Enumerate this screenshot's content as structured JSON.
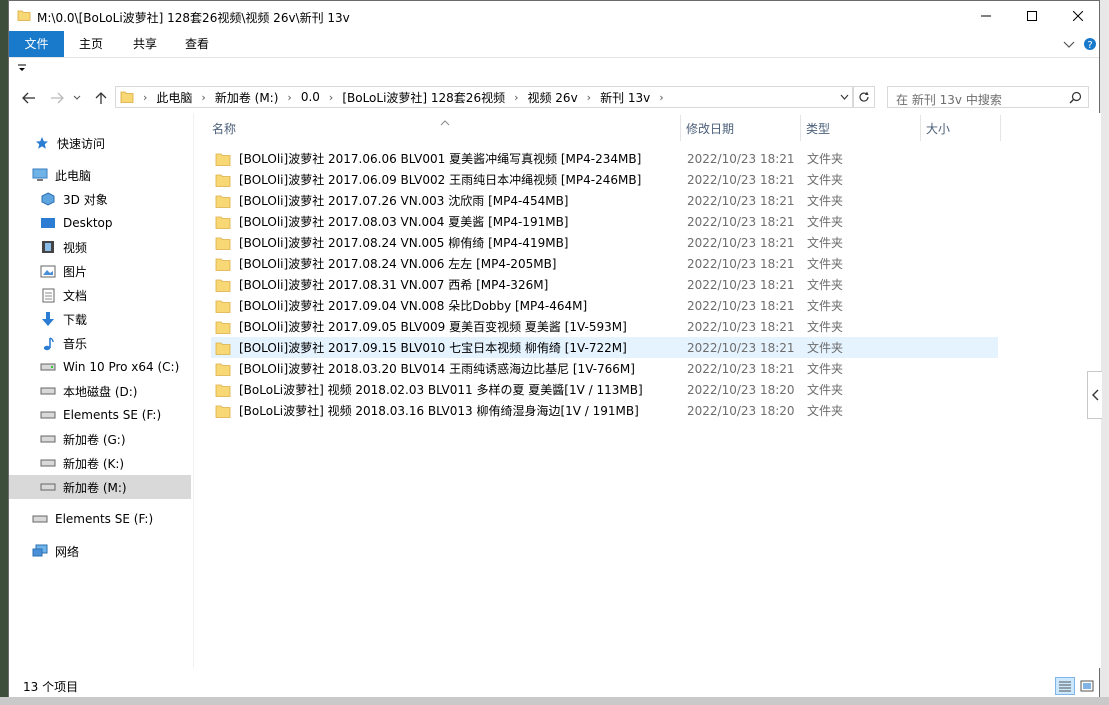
{
  "window": {
    "title": "M:\\0.0\\[BoLoLi波萝社] 128套26视频\\视频 26v\\新刊 13v"
  },
  "ribbon": {
    "tabs": [
      "文件",
      "主页",
      "共享",
      "查看"
    ],
    "active_color": "#1979ca"
  },
  "address": {
    "crumbs": [
      "此电脑",
      "新加卷 (M:)",
      "0.0",
      "[BoLoLi波萝社] 128套26视频",
      "视频 26v",
      "新刊 13v"
    ]
  },
  "search": {
    "placeholder": "在 新刊 13v 中搜索"
  },
  "nav": {
    "items": [
      {
        "label": "快速访问",
        "icon": "star-icon"
      },
      {
        "label": "此电脑",
        "icon": "computer-icon"
      },
      {
        "label": "3D 对象",
        "icon": "3d-objects-icon"
      },
      {
        "label": "Desktop",
        "icon": "desktop-icon"
      },
      {
        "label": "视频",
        "icon": "video-icon"
      },
      {
        "label": "图片",
        "icon": "pictures-icon"
      },
      {
        "label": "文档",
        "icon": "documents-icon"
      },
      {
        "label": "下载",
        "icon": "download-icon"
      },
      {
        "label": "音乐",
        "icon": "music-icon"
      },
      {
        "label": "Win 10 Pro x64 (C:)",
        "icon": "drive-icon"
      },
      {
        "label": "本地磁盘 (D:)",
        "icon": "drive-icon"
      },
      {
        "label": "Elements SE (F:)",
        "icon": "drive-icon"
      },
      {
        "label": "新加卷 (G:)",
        "icon": "drive-icon"
      },
      {
        "label": "新加卷 (K:)",
        "icon": "drive-icon"
      },
      {
        "label": "新加卷 (M:)",
        "icon": "drive-icon",
        "selected": true
      },
      {
        "label": "Elements SE (F:)",
        "icon": "drive-icon"
      },
      {
        "label": "网络",
        "icon": "network-icon"
      }
    ]
  },
  "columns": {
    "name": "名称",
    "date": "修改日期",
    "type": "类型",
    "size": "大小"
  },
  "files": [
    {
      "name": "[BOLOli]波萝社 2017.06.06 BLV001 夏美酱冲绳写真视频 [MP4-234MB]",
      "date": "2022/10/23 18:21",
      "type": "文件夹"
    },
    {
      "name": "[BOLOli]波萝社 2017.06.09 BLV002 王雨纯日本冲绳视频 [MP4-246MB]",
      "date": "2022/10/23 18:21",
      "type": "文件夹"
    },
    {
      "name": "[BOLOli]波萝社 2017.07.26 VN.003 沈欣雨 [MP4-454MB]",
      "date": "2022/10/23 18:21",
      "type": "文件夹"
    },
    {
      "name": "[BOLOli]波萝社 2017.08.03 VN.004 夏美酱 [MP4-191MB]",
      "date": "2022/10/23 18:21",
      "type": "文件夹"
    },
    {
      "name": "[BOLOli]波萝社 2017.08.24 VN.005 柳侑绮 [MP4-419MB]",
      "date": "2022/10/23 18:21",
      "type": "文件夹"
    },
    {
      "name": "[BOLOli]波萝社 2017.08.24 VN.006 左左 [MP4-205MB]",
      "date": "2022/10/23 18:21",
      "type": "文件夹"
    },
    {
      "name": "[BOLOli]波萝社 2017.08.31 VN.007 西希 [MP4-326M]",
      "date": "2022/10/23 18:21",
      "type": "文件夹"
    },
    {
      "name": "[BOLOli]波萝社 2017.09.04 VN.008 朵比Dobby [MP4-464M]",
      "date": "2022/10/23 18:21",
      "type": "文件夹"
    },
    {
      "name": "[BOLOli]波萝社 2017.09.05 BLV009 夏美百变视频 夏美酱 [1V-593M]",
      "date": "2022/10/23 18:21",
      "type": "文件夹"
    },
    {
      "name": "[BOLOli]波萝社 2017.09.15 BLV010 七宝日本视频 柳侑绮 [1V-722M]",
      "date": "2022/10/23 18:21",
      "type": "文件夹",
      "hover": true
    },
    {
      "name": "[BOLOli]波萝社 2018.03.20 BLV014 王雨纯诱惑海边比基尼 [1V-766M]",
      "date": "2022/10/23 18:21",
      "type": "文件夹"
    },
    {
      "name": "[BoLoLi波萝社] 视频 2018.02.03 BLV011 多样の夏 夏美醬[1V / 113MB]",
      "date": "2022/10/23 18:20",
      "type": "文件夹"
    },
    {
      "name": "[BoLoLi波萝社] 视频 2018.03.16 BLV013 柳侑绮湿身海边[1V / 191MB]",
      "date": "2022/10/23 18:20",
      "type": "文件夹"
    }
  ],
  "status": {
    "count_text": "13 个项目"
  }
}
